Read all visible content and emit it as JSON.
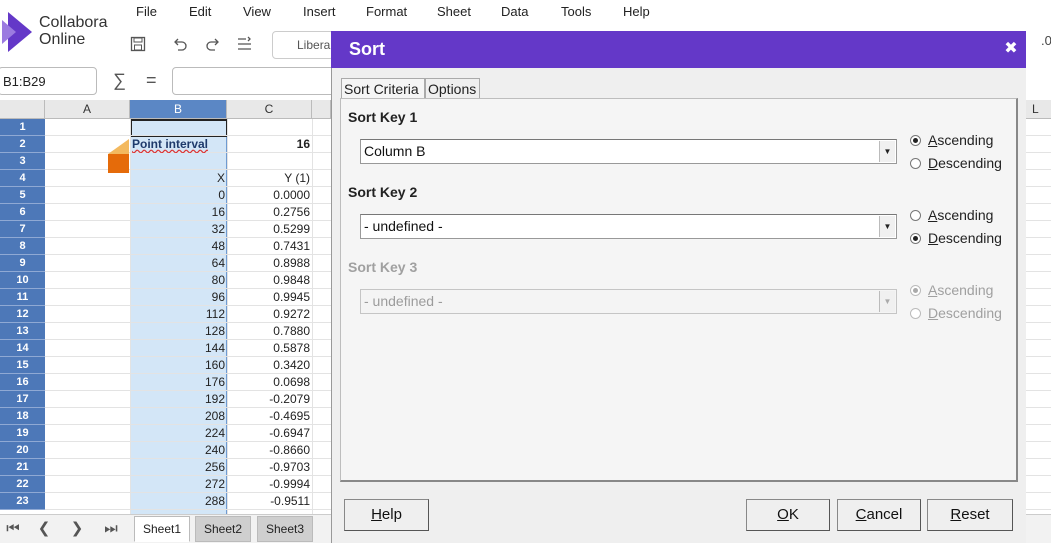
{
  "app": {
    "logo_line1": "Collabora",
    "logo_line2": "Online",
    "brand_color": "#6438c8"
  },
  "menu": [
    "File",
    "Edit",
    "View",
    "Insert",
    "Format",
    "Sheet",
    "Data",
    "Tools",
    "Help"
  ],
  "toolbar": {
    "icons": [
      "save-icon",
      "undo-icon",
      "redo-icon",
      "clone-formatting-icon"
    ],
    "font_name": "Libera",
    "right_fragment": ".0"
  },
  "formula_bar": {
    "name_box": "B1:B29",
    "formula": ""
  },
  "columns": [
    "A",
    "B",
    "C"
  ],
  "extra_column": "L",
  "rows": [
    {
      "n": "1",
      "b": "",
      "c": ""
    },
    {
      "n": "2",
      "b": "Point interval",
      "c": "16"
    },
    {
      "n": "3",
      "b": "",
      "c": ""
    },
    {
      "n": "4",
      "b": "X",
      "c": "Y (1)"
    },
    {
      "n": "5",
      "b": "0",
      "c": "0.0000"
    },
    {
      "n": "6",
      "b": "16",
      "c": "0.2756"
    },
    {
      "n": "7",
      "b": "32",
      "c": "0.5299"
    },
    {
      "n": "8",
      "b": "48",
      "c": "0.7431"
    },
    {
      "n": "9",
      "b": "64",
      "c": "0.8988"
    },
    {
      "n": "10",
      "b": "80",
      "c": "0.9848"
    },
    {
      "n": "11",
      "b": "96",
      "c": "0.9945"
    },
    {
      "n": "12",
      "b": "112",
      "c": "0.9272"
    },
    {
      "n": "13",
      "b": "128",
      "c": "0.7880"
    },
    {
      "n": "14",
      "b": "144",
      "c": "0.5878"
    },
    {
      "n": "15",
      "b": "160",
      "c": "0.3420"
    },
    {
      "n": "16",
      "b": "176",
      "c": "0.0698"
    },
    {
      "n": "17",
      "b": "192",
      "c": "-0.2079"
    },
    {
      "n": "18",
      "b": "208",
      "c": "-0.4695"
    },
    {
      "n": "19",
      "b": "224",
      "c": "-0.6947"
    },
    {
      "n": "20",
      "b": "240",
      "c": "-0.8660"
    },
    {
      "n": "21",
      "b": "256",
      "c": "-0.9703"
    },
    {
      "n": "22",
      "b": "272",
      "c": "-0.9994"
    },
    {
      "n": "23",
      "b": "288",
      "c": "-0.9511"
    }
  ],
  "sheets": [
    {
      "label": "Sheet1",
      "active": true
    },
    {
      "label": "Sheet2",
      "active": false
    },
    {
      "label": "Sheet3",
      "active": false
    }
  ],
  "dialog": {
    "title": "Sort",
    "close": "✖",
    "tabs": [
      "Sort Criteria",
      "Options"
    ],
    "sort_keys": [
      {
        "label": "Sort Key 1",
        "value": "Column B",
        "order": "ascending",
        "enabled": true
      },
      {
        "label": "Sort Key 2",
        "value": "- undefined -",
        "order": "descending",
        "enabled": true
      },
      {
        "label": "Sort Key 3",
        "value": "- undefined -",
        "order": "ascending",
        "enabled": false
      }
    ],
    "ascending_label": "Ascending",
    "descending_label": "Descending",
    "buttons": {
      "help": "Help",
      "ok": "OK",
      "cancel": "Cancel",
      "reset": "Reset"
    }
  }
}
